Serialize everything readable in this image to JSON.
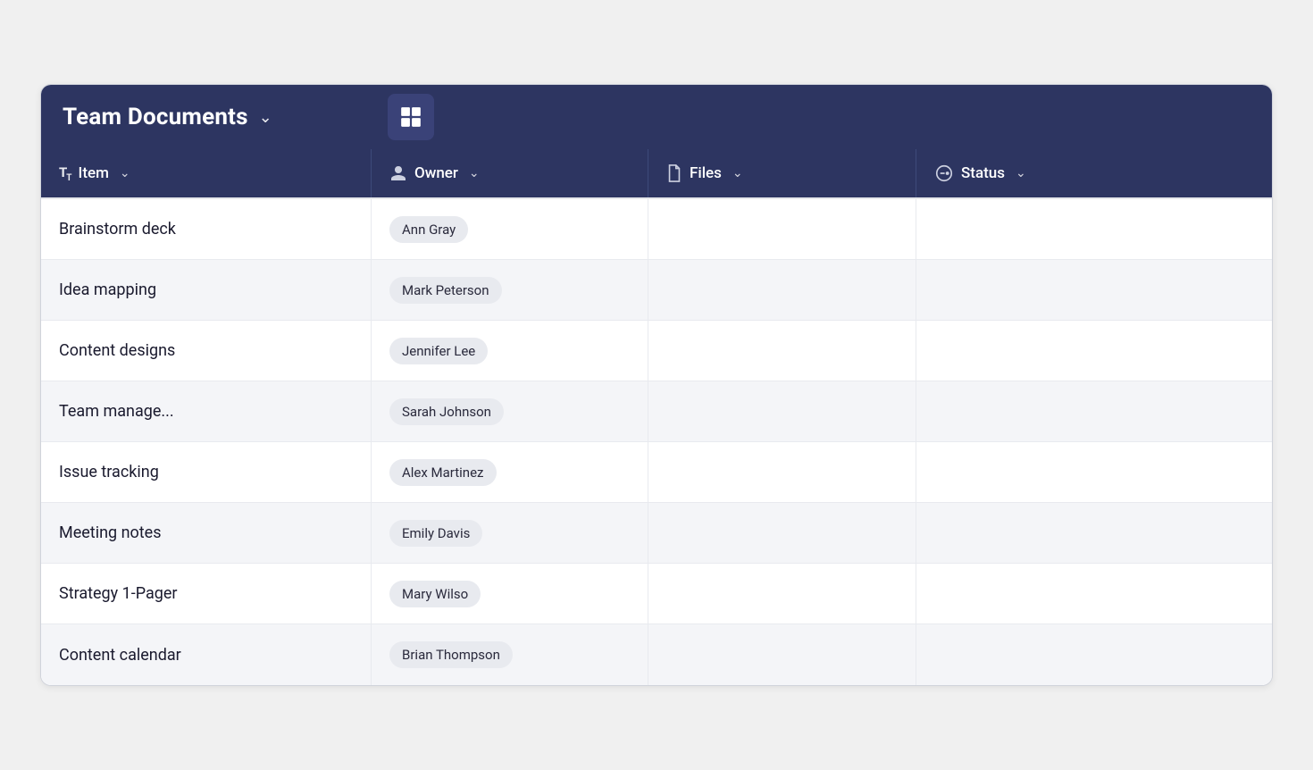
{
  "header": {
    "title": "Team Documents",
    "chevron_label": "▾",
    "grid_icon_label": "grid-view"
  },
  "columns": [
    {
      "id": "item",
      "label": "Item",
      "icon": "text-type-icon"
    },
    {
      "id": "owner",
      "label": "Owner",
      "icon": "person-icon"
    },
    {
      "id": "files",
      "label": "Files",
      "icon": "file-icon"
    },
    {
      "id": "status",
      "label": "Status",
      "icon": "status-icon"
    }
  ],
  "rows": [
    {
      "item": "Brainstorm deck",
      "owner": "Ann Gray"
    },
    {
      "item": "Idea mapping",
      "owner": "Mark Peterson"
    },
    {
      "item": "Content designs",
      "owner": "Jennifer Lee"
    },
    {
      "item": "Team manage...",
      "owner": "Sarah Johnson"
    },
    {
      "item": "Issue tracking",
      "owner": "Alex Martinez"
    },
    {
      "item": "Meeting notes",
      "owner": "Emily Davis"
    },
    {
      "item": "Strategy 1-Pager",
      "owner": "Mary Wilso"
    },
    {
      "item": "Content calendar",
      "owner": "Brian Thompson"
    }
  ],
  "colors": {
    "header_bg": "#2d3561",
    "row_even_bg": "#f4f5f8",
    "row_odd_bg": "#ffffff",
    "owner_badge_bg": "#e8eaef",
    "text_primary": "#1a1a2e"
  }
}
